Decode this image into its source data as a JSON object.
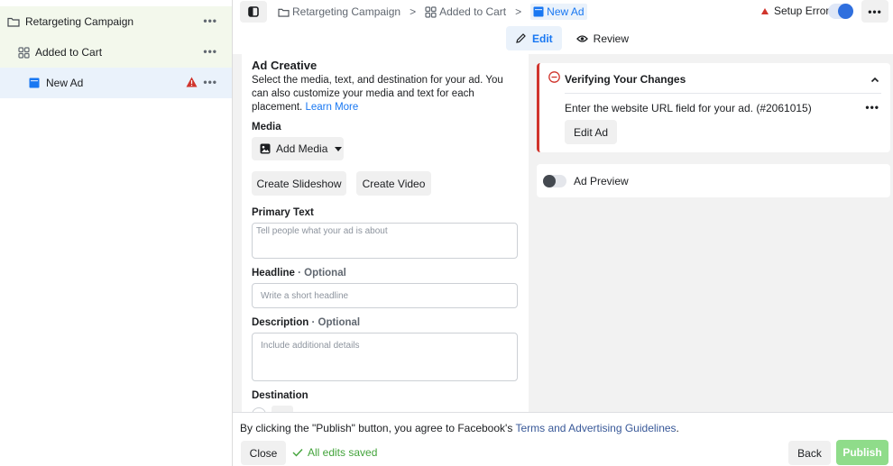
{
  "sidebar": {
    "items": [
      {
        "label": "Retargeting Campaign",
        "icon": "folder-icon",
        "level": "campaign"
      },
      {
        "label": "Added to Cart",
        "icon": "ad-set-grid-icon",
        "level": "ad-set"
      },
      {
        "label": "New Ad",
        "icon": "ad-icon",
        "level": "ad",
        "warning": true
      }
    ],
    "more_glyph": "•••"
  },
  "topbar": {
    "breadcrumbs": [
      {
        "label": "Retargeting Campaign",
        "icon": "folder-icon"
      },
      {
        "label": "Added to Cart",
        "icon": "ad-set-grid-icon"
      },
      {
        "label": "New Ad",
        "icon": "ad-icon",
        "active": true
      }
    ],
    "separator": ">",
    "status": "Setup Error",
    "toggle_on": true,
    "more_glyph": "•••",
    "tabs": [
      {
        "label": "Edit",
        "icon": "pencil-icon",
        "active": true
      },
      {
        "label": "Review",
        "icon": "eye-icon",
        "active": false
      }
    ]
  },
  "form": {
    "section_title": "Ad Creative",
    "section_desc": "Select the media, text, and destination for your ad. You can also customize your media and text for each placement.",
    "learn_more": "Learn More",
    "media_label": "Media",
    "add_media": "Add Media",
    "create_slideshow": "Create Slideshow",
    "create_video": "Create Video",
    "primary_text_label": "Primary Text",
    "primary_text_placeholder": "Tell people what your ad is about",
    "headline_label": "Headline",
    "optional": "· Optional",
    "headline_placeholder": "Write a short headline",
    "description_label": "Description",
    "description_placeholder": "Include additional details",
    "destination_label": "Destination"
  },
  "verify": {
    "title": "Verifying Your Changes",
    "message": "Enter the website URL field for your ad. (#2061015)",
    "edit_ad": "Edit Ad",
    "more_glyph": "•••",
    "accent_color": "#d0342c"
  },
  "preview": {
    "label": "Ad Preview",
    "toggle_on": false
  },
  "footer": {
    "agreement_prefix": "By clicking the \"Publish\" button, you agree to Facebook's",
    "agreement_link": "Terms and Advertising Guidelines",
    "agreement_suffix": ".",
    "close": "Close",
    "saved_status": "All edits saved",
    "back": "Back",
    "publish": "Publish"
  },
  "colors": {
    "brand_blue": "#1877f2",
    "error_red": "#d0342c",
    "success_green": "#42a33a",
    "publish_disabled": "#8fdc8a"
  }
}
